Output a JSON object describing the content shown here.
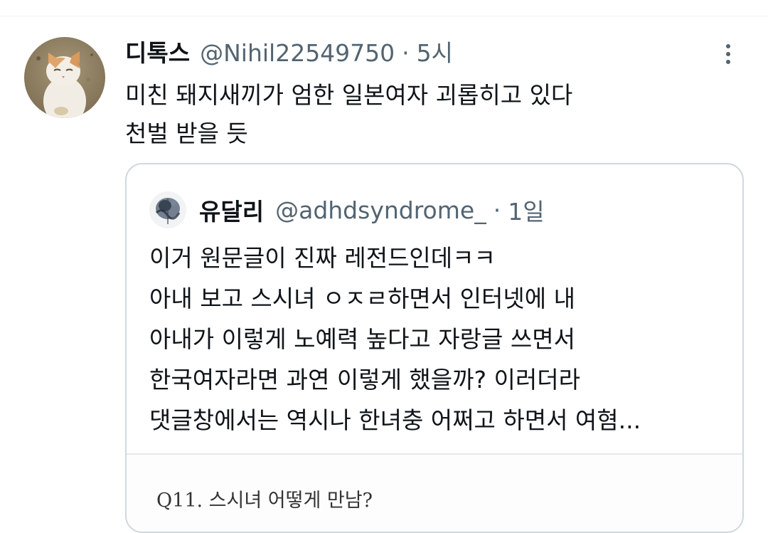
{
  "tweet": {
    "display_name": "디톡스",
    "handle": "@Nihil22549750",
    "separator": "·",
    "time": "5시",
    "text_lines": [
      "미친 돼지새끼가 엄한 일본여자 괴롭히고 있다",
      "천벌 받을 듯"
    ],
    "avatar_icon": "cat-avatar-icon",
    "more_icon": "more-options-icon"
  },
  "quote": {
    "display_name": "유달리",
    "handle": "@adhdsyndrome_",
    "separator": "·",
    "time": "1일",
    "avatar_icon": "ink-avatar-icon",
    "text_lines": [
      "이거 원문글이 진짜 레전드인데ㅋㅋ",
      "아내 보고 스시녀 ㅇㅈㄹ하면서 인터넷에 내",
      "아내가 이렇게 노예력 높다고 자랑글 쓰면서",
      "한국여자라면 과연 이렇게 했을까? 이러더라",
      "댓글창에서는 역시나 한녀충 어쩌고 하면서 여혐..."
    ],
    "media_caption": "Q11. 스시녀 어떻게 만남?"
  },
  "colors": {
    "text_primary": "#0f1419",
    "text_secondary": "#536471",
    "border": "#cfd9de",
    "background": "#ffffff"
  }
}
